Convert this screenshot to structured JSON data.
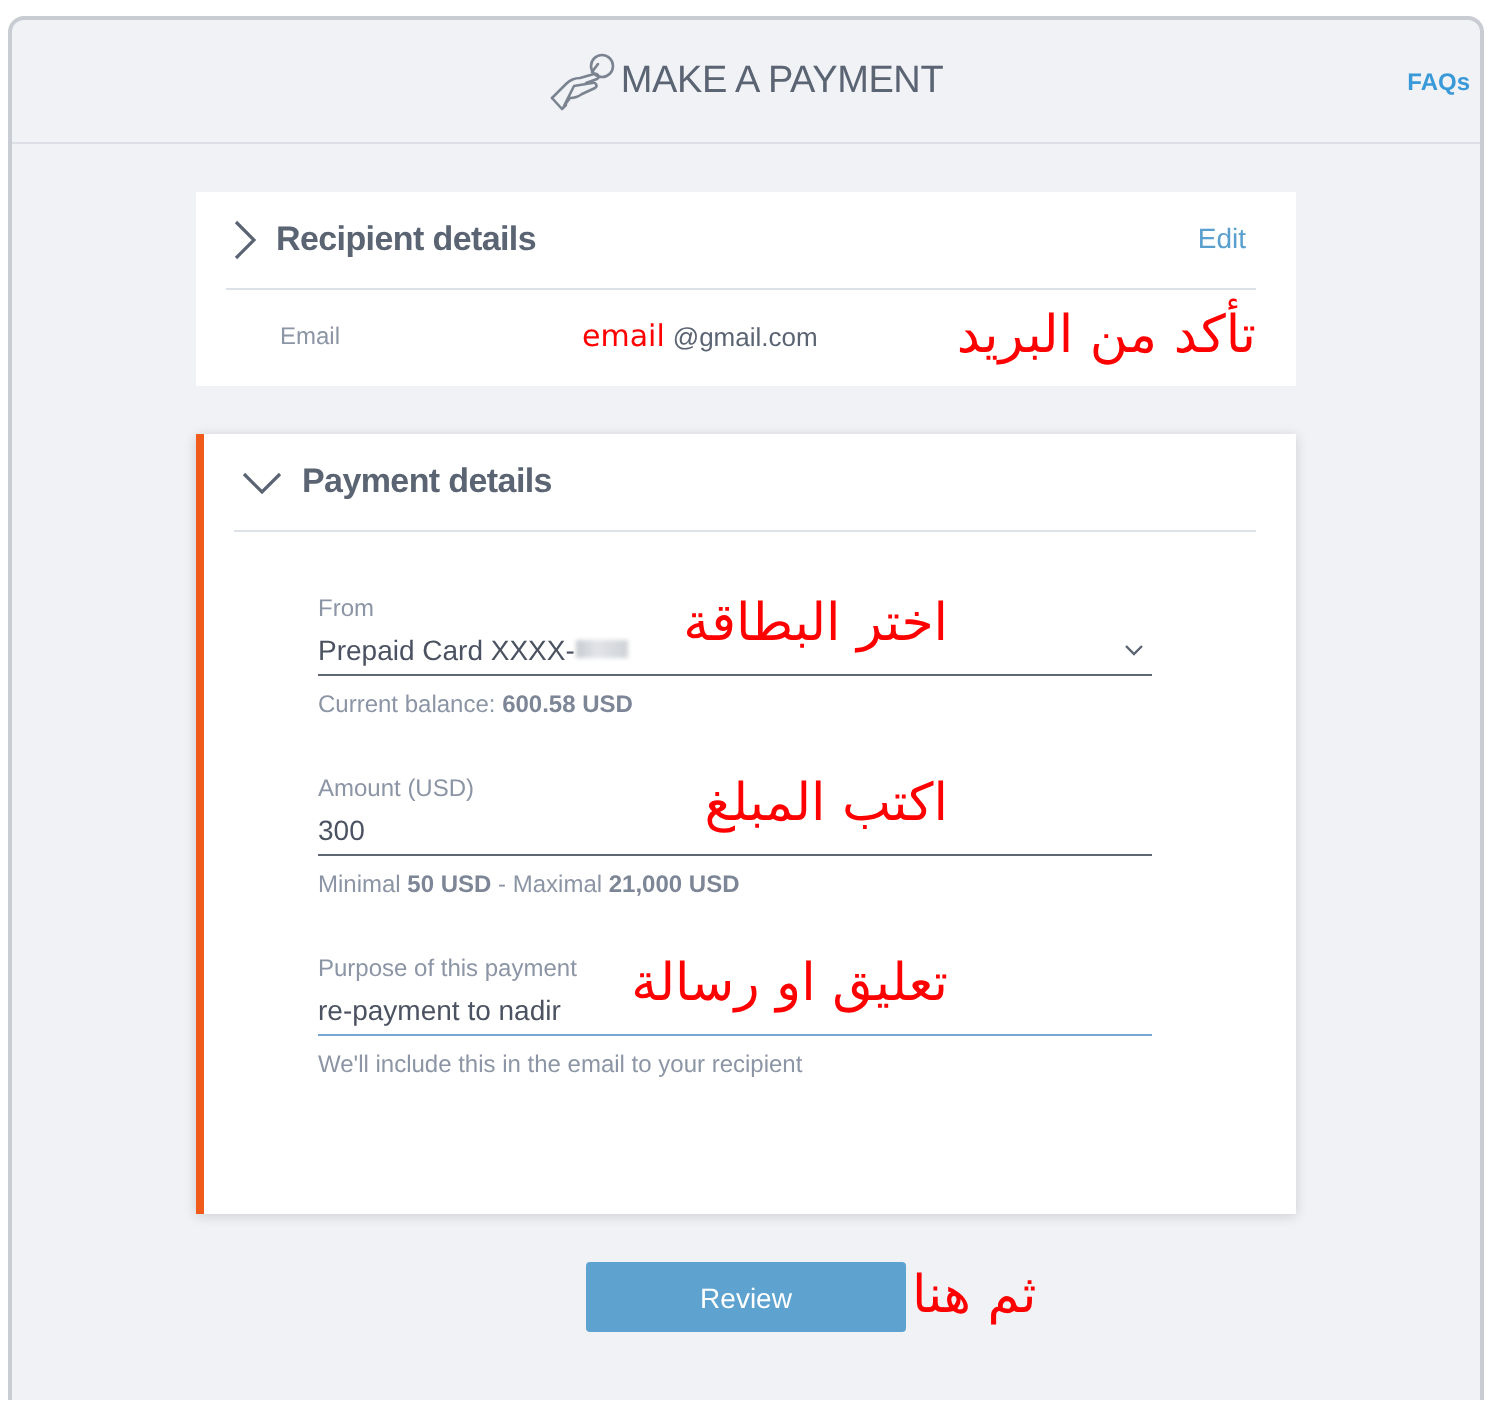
{
  "header": {
    "title": "MAKE A PAYMENT",
    "faq_link": "FAQs"
  },
  "sections": [
    {
      "kind": "summary",
      "title": "Recipient details",
      "expanded": false,
      "active": false,
      "action": "Edit",
      "rows": [
        {
          "label": "Email",
          "value_annotation": "email",
          "value": "@gmail.com",
          "annotation": "تأكد من البريد"
        }
      ]
    },
    {
      "kind": "form",
      "title": "Payment details",
      "expanded": true,
      "active": true,
      "fields": [
        {
          "kind": "select",
          "label": "From",
          "value": "Prepaid Card XXXX-",
          "redacted": true,
          "focused": false,
          "help": "Current balance: **600.58 USD**",
          "annotation": "اختر البطاقة"
        },
        {
          "kind": "text",
          "label": "Amount (USD)",
          "value": "300",
          "redacted": false,
          "focused": false,
          "help": "Minimal **50 USD** - Maximal **21,000 USD**",
          "annotation": "اكتب المبلغ"
        },
        {
          "kind": "text",
          "label": "Purpose of this payment",
          "value": "re-payment to nadir",
          "redacted": false,
          "focused": true,
          "help": "We'll include this in the email to your recipient",
          "annotation": "تعليق او رسالة"
        }
      ]
    }
  ],
  "submit": {
    "label": "Review",
    "annotation": "ثم هنا"
  }
}
